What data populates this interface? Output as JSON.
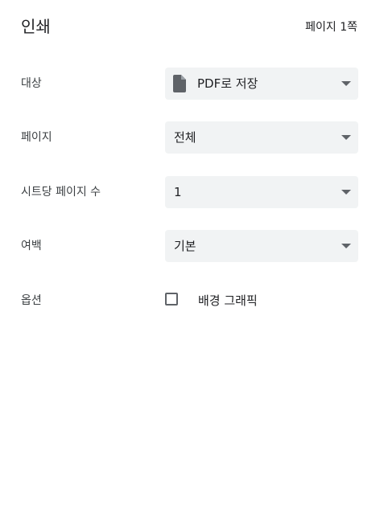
{
  "header": {
    "title": "인쇄",
    "page_count": "페이지 1쪽"
  },
  "settings": {
    "destination": {
      "label": "대상",
      "value": "PDF로 저장",
      "icon": "file-icon"
    },
    "pages": {
      "label": "페이지",
      "value": "전체"
    },
    "pages_per_sheet": {
      "label": "시트당 페이지 수",
      "value": "1"
    },
    "margins": {
      "label": "여백",
      "value": "기본"
    },
    "options": {
      "label": "옵션",
      "background_graphics_label": "배경 그래픽",
      "background_graphics_checked": false
    }
  },
  "colors": {
    "select_background": "#f1f3f4",
    "icon": "#5f6368",
    "text": "#202124"
  }
}
